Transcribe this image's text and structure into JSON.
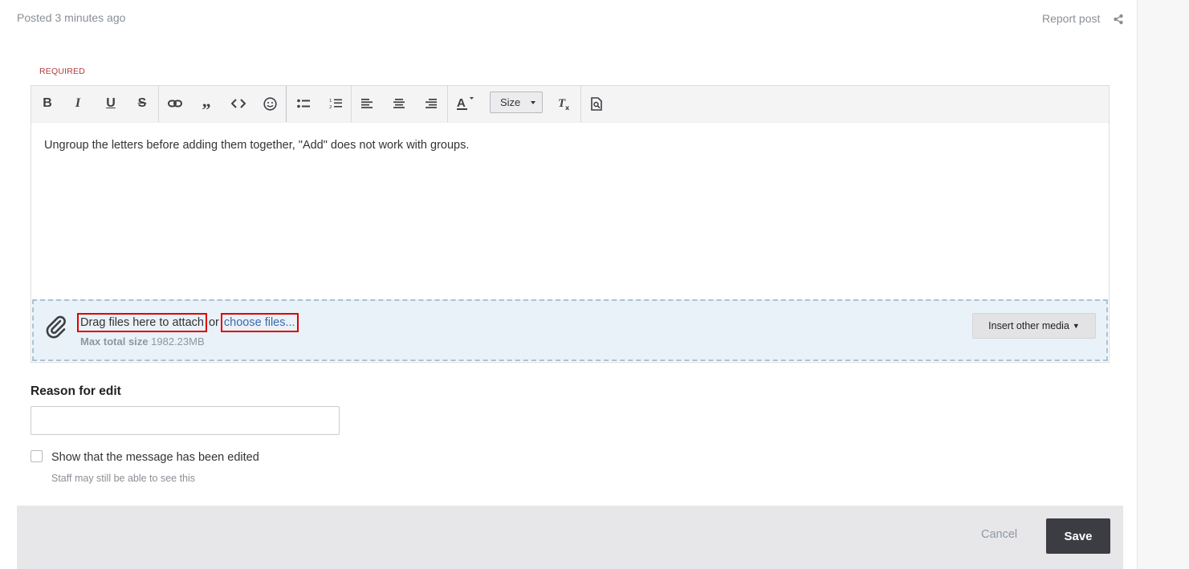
{
  "post": {
    "posted": "Posted 3 minutes ago",
    "report": "Report post"
  },
  "editor": {
    "required_label": "REQUIRED",
    "size_label": "Size",
    "content": "Ungroup the letters before adding them together, \"Add\" does not work with groups."
  },
  "attach": {
    "drag_text": "Drag files here to attach",
    "or_text": " or ",
    "choose_text": "choose files...",
    "max_label": "Max total size",
    "max_value": " 1982.23MB",
    "insert_media": "Insert other media"
  },
  "reason": {
    "label": "Reason for edit",
    "value": ""
  },
  "options": {
    "show_edited": "Show that the message has been edited",
    "hint": "Staff may still be able to see this"
  },
  "actions": {
    "cancel": "Cancel",
    "save": "Save"
  },
  "colors": {
    "required": "#b33a3a",
    "link": "#3d6aa6",
    "dropzone_bg": "#e9f2f8",
    "save_bg": "#3b3d42",
    "highlight": "#e00000"
  }
}
